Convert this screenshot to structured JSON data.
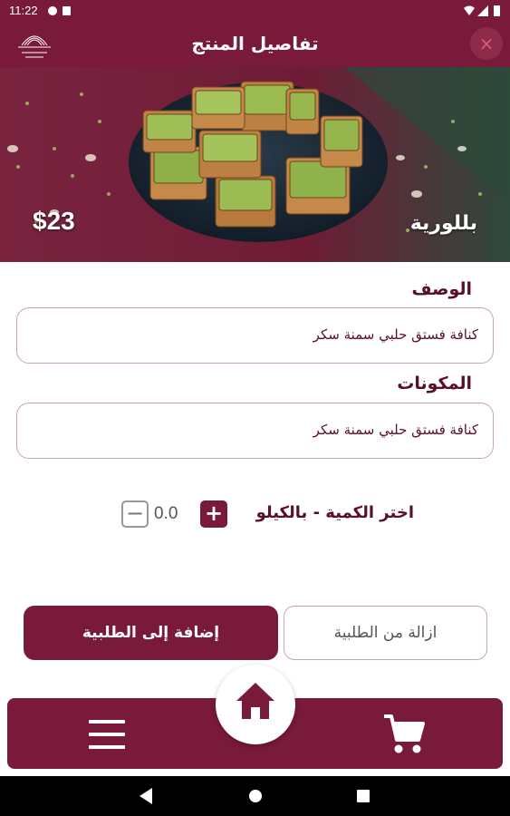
{
  "status_bar": {
    "time": "11:22"
  },
  "header": {
    "title": "تفاصيل المنتج",
    "logo_icon": "shop-logo-icon",
    "close_glyph": "×"
  },
  "product": {
    "name": "بللورية",
    "price": "$23"
  },
  "description": {
    "label": "الوصف",
    "value": "كنافة فستق حلبي سمنة سكر"
  },
  "ingredients": {
    "label": "المكونات",
    "value": "كنافة فستق حلبي سمنة سكر"
  },
  "quantity": {
    "label": "اختر الكمية - بالكيلو",
    "value": "0.0",
    "plus": "+",
    "minus": "−"
  },
  "actions": {
    "add_label": "إضافة إلى الطلبية",
    "remove_label": "ازالة من الطلبية"
  },
  "bottom_nav": {
    "menu_icon": "hamburger-menu-icon",
    "home_icon": "home-icon",
    "cart_icon": "shopping-cart-icon"
  },
  "colors": {
    "primary": "#7a1a3a",
    "text_dark": "#5a0f28",
    "border": "#c9a5b3"
  }
}
